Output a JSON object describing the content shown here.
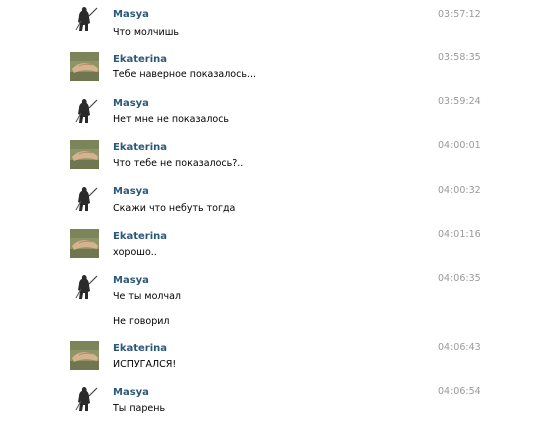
{
  "messages": [
    {
      "author": "Masya",
      "avatar": "masya-avatar",
      "time": "03:57:12",
      "lines": [
        "Что молчишь"
      ]
    },
    {
      "author": "Ekaterina",
      "avatar": "ekaterina-avatar",
      "time": "03:58:35",
      "lines": [
        "Тебе наверное показалось..."
      ]
    },
    {
      "author": "Masya",
      "avatar": "masya-avatar",
      "time": "03:59:24",
      "lines": [
        "Нет мне не показалось"
      ]
    },
    {
      "author": "Ekaterina",
      "avatar": "ekaterina-avatar",
      "time": "04:00:01",
      "lines": [
        "Что тебе не показалось?.."
      ]
    },
    {
      "author": "Masya",
      "avatar": "masya-avatar",
      "time": "04:00:32",
      "lines": [
        "Скажи что небуть тогда"
      ]
    },
    {
      "author": "Ekaterina",
      "avatar": "ekaterina-avatar",
      "time": "04:01:16",
      "lines": [
        "хорошо.."
      ]
    },
    {
      "author": "Masya",
      "avatar": "masya-avatar",
      "time": "04:06:35",
      "lines": [
        "Че ты молчал",
        "Не говорил"
      ]
    },
    {
      "author": "Ekaterina",
      "avatar": "ekaterina-avatar",
      "time": "04:06:43",
      "lines": [
        "ИСПУГАЛСЯ!"
      ]
    },
    {
      "author": "Masya",
      "avatar": "masya-avatar",
      "time": "04:06:54",
      "lines": [
        "Ты парень"
      ]
    }
  ],
  "colors": {
    "author": "#2b587a",
    "time": "#999999",
    "text": "#000000",
    "background": "#ffffff"
  }
}
